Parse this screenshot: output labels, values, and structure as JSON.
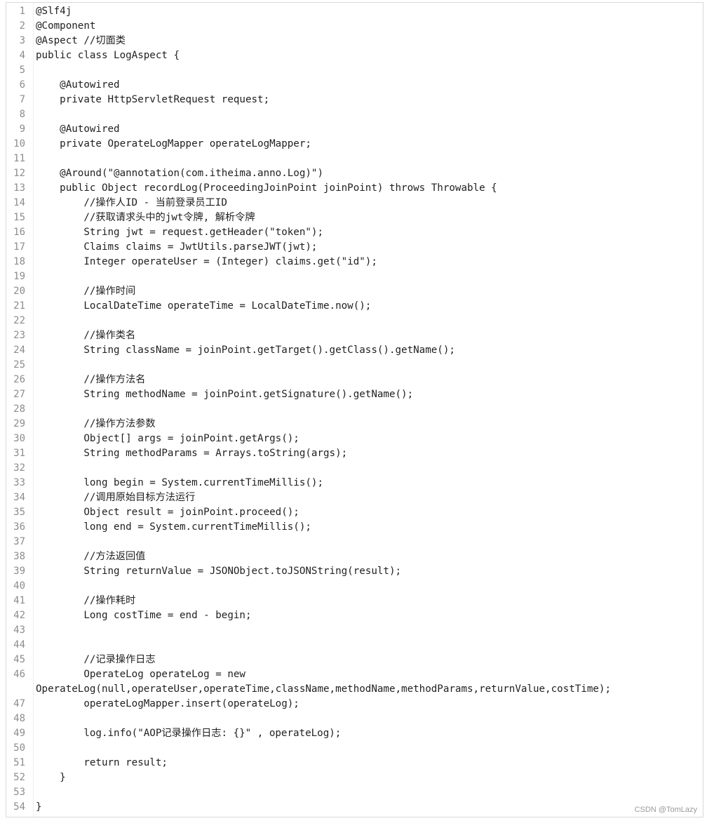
{
  "code": {
    "lines": [
      {
        "n": "1",
        "t": "@Slf4j"
      },
      {
        "n": "2",
        "t": "@Component"
      },
      {
        "n": "3",
        "t": "@Aspect //切面类"
      },
      {
        "n": "4",
        "t": "public class LogAspect {"
      },
      {
        "n": "5",
        "t": ""
      },
      {
        "n": "6",
        "t": "    @Autowired"
      },
      {
        "n": "7",
        "t": "    private HttpServletRequest request;"
      },
      {
        "n": "8",
        "t": ""
      },
      {
        "n": "9",
        "t": "    @Autowired"
      },
      {
        "n": "10",
        "t": "    private OperateLogMapper operateLogMapper;"
      },
      {
        "n": "11",
        "t": ""
      },
      {
        "n": "12",
        "t": "    @Around(\"@annotation(com.itheima.anno.Log)\")"
      },
      {
        "n": "13",
        "t": "    public Object recordLog(ProceedingJoinPoint joinPoint) throws Throwable {"
      },
      {
        "n": "14",
        "t": "        //操作人ID - 当前登录员工ID"
      },
      {
        "n": "15",
        "t": "        //获取请求头中的jwt令牌, 解析令牌"
      },
      {
        "n": "16",
        "t": "        String jwt = request.getHeader(\"token\");"
      },
      {
        "n": "17",
        "t": "        Claims claims = JwtUtils.parseJWT(jwt);"
      },
      {
        "n": "18",
        "t": "        Integer operateUser = (Integer) claims.get(\"id\");"
      },
      {
        "n": "19",
        "t": ""
      },
      {
        "n": "20",
        "t": "        //操作时间"
      },
      {
        "n": "21",
        "t": "        LocalDateTime operateTime = LocalDateTime.now();"
      },
      {
        "n": "22",
        "t": ""
      },
      {
        "n": "23",
        "t": "        //操作类名"
      },
      {
        "n": "24",
        "t": "        String className = joinPoint.getTarget().getClass().getName();"
      },
      {
        "n": "25",
        "t": ""
      },
      {
        "n": "26",
        "t": "        //操作方法名"
      },
      {
        "n": "27",
        "t": "        String methodName = joinPoint.getSignature().getName();"
      },
      {
        "n": "28",
        "t": ""
      },
      {
        "n": "29",
        "t": "        //操作方法参数"
      },
      {
        "n": "30",
        "t": "        Object[] args = joinPoint.getArgs();"
      },
      {
        "n": "31",
        "t": "        String methodParams = Arrays.toString(args);"
      },
      {
        "n": "32",
        "t": ""
      },
      {
        "n": "33",
        "t": "        long begin = System.currentTimeMillis();"
      },
      {
        "n": "34",
        "t": "        //调用原始目标方法运行"
      },
      {
        "n": "35",
        "t": "        Object result = joinPoint.proceed();"
      },
      {
        "n": "36",
        "t": "        long end = System.currentTimeMillis();"
      },
      {
        "n": "37",
        "t": ""
      },
      {
        "n": "38",
        "t": "        //方法返回值"
      },
      {
        "n": "39",
        "t": "        String returnValue = JSONObject.toJSONString(result);"
      },
      {
        "n": "40",
        "t": ""
      },
      {
        "n": "41",
        "t": "        //操作耗时"
      },
      {
        "n": "42",
        "t": "        Long costTime = end - begin;"
      },
      {
        "n": "43",
        "t": ""
      },
      {
        "n": "44",
        "t": ""
      },
      {
        "n": "45",
        "t": "        //记录操作日志"
      },
      {
        "n": "46",
        "t": "        OperateLog operateLog = new"
      },
      {
        "n": "",
        "t": "OperateLog(null,operateUser,operateTime,className,methodName,methodParams,returnValue,costTime);"
      },
      {
        "n": "47",
        "t": "        operateLogMapper.insert(operateLog);"
      },
      {
        "n": "48",
        "t": ""
      },
      {
        "n": "49",
        "t": "        log.info(\"AOP记录操作日志: {}\" , operateLog);"
      },
      {
        "n": "50",
        "t": ""
      },
      {
        "n": "51",
        "t": "        return result;"
      },
      {
        "n": "52",
        "t": "    }"
      },
      {
        "n": "53",
        "t": ""
      },
      {
        "n": "54",
        "t": "}"
      }
    ]
  },
  "watermark": "CSDN @TomLazy"
}
